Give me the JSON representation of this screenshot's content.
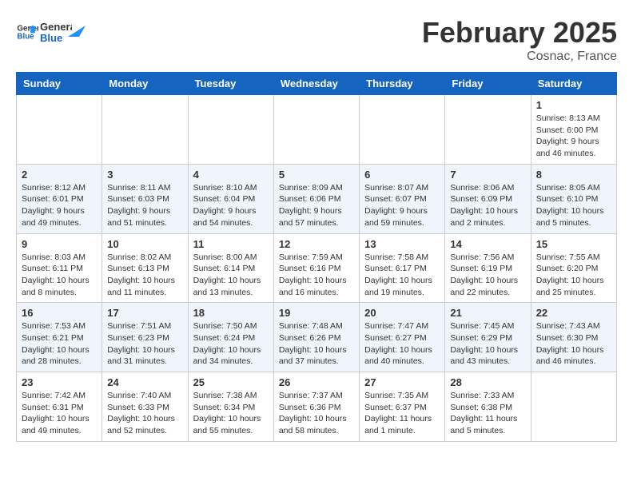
{
  "header": {
    "logo_line1": "General",
    "logo_line2": "Blue",
    "month_title": "February 2025",
    "location": "Cosnac, France"
  },
  "weekdays": [
    "Sunday",
    "Monday",
    "Tuesday",
    "Wednesday",
    "Thursday",
    "Friday",
    "Saturday"
  ],
  "weeks": [
    [
      {
        "day": "",
        "info": ""
      },
      {
        "day": "",
        "info": ""
      },
      {
        "day": "",
        "info": ""
      },
      {
        "day": "",
        "info": ""
      },
      {
        "day": "",
        "info": ""
      },
      {
        "day": "",
        "info": ""
      },
      {
        "day": "1",
        "info": "Sunrise: 8:13 AM\nSunset: 6:00 PM\nDaylight: 9 hours and 46 minutes."
      }
    ],
    [
      {
        "day": "2",
        "info": "Sunrise: 8:12 AM\nSunset: 6:01 PM\nDaylight: 9 hours and 49 minutes."
      },
      {
        "day": "3",
        "info": "Sunrise: 8:11 AM\nSunset: 6:03 PM\nDaylight: 9 hours and 51 minutes."
      },
      {
        "day": "4",
        "info": "Sunrise: 8:10 AM\nSunset: 6:04 PM\nDaylight: 9 hours and 54 minutes."
      },
      {
        "day": "5",
        "info": "Sunrise: 8:09 AM\nSunset: 6:06 PM\nDaylight: 9 hours and 57 minutes."
      },
      {
        "day": "6",
        "info": "Sunrise: 8:07 AM\nSunset: 6:07 PM\nDaylight: 9 hours and 59 minutes."
      },
      {
        "day": "7",
        "info": "Sunrise: 8:06 AM\nSunset: 6:09 PM\nDaylight: 10 hours and 2 minutes."
      },
      {
        "day": "8",
        "info": "Sunrise: 8:05 AM\nSunset: 6:10 PM\nDaylight: 10 hours and 5 minutes."
      }
    ],
    [
      {
        "day": "9",
        "info": "Sunrise: 8:03 AM\nSunset: 6:11 PM\nDaylight: 10 hours and 8 minutes."
      },
      {
        "day": "10",
        "info": "Sunrise: 8:02 AM\nSunset: 6:13 PM\nDaylight: 10 hours and 11 minutes."
      },
      {
        "day": "11",
        "info": "Sunrise: 8:00 AM\nSunset: 6:14 PM\nDaylight: 10 hours and 13 minutes."
      },
      {
        "day": "12",
        "info": "Sunrise: 7:59 AM\nSunset: 6:16 PM\nDaylight: 10 hours and 16 minutes."
      },
      {
        "day": "13",
        "info": "Sunrise: 7:58 AM\nSunset: 6:17 PM\nDaylight: 10 hours and 19 minutes."
      },
      {
        "day": "14",
        "info": "Sunrise: 7:56 AM\nSunset: 6:19 PM\nDaylight: 10 hours and 22 minutes."
      },
      {
        "day": "15",
        "info": "Sunrise: 7:55 AM\nSunset: 6:20 PM\nDaylight: 10 hours and 25 minutes."
      }
    ],
    [
      {
        "day": "16",
        "info": "Sunrise: 7:53 AM\nSunset: 6:21 PM\nDaylight: 10 hours and 28 minutes."
      },
      {
        "day": "17",
        "info": "Sunrise: 7:51 AM\nSunset: 6:23 PM\nDaylight: 10 hours and 31 minutes."
      },
      {
        "day": "18",
        "info": "Sunrise: 7:50 AM\nSunset: 6:24 PM\nDaylight: 10 hours and 34 minutes."
      },
      {
        "day": "19",
        "info": "Sunrise: 7:48 AM\nSunset: 6:26 PM\nDaylight: 10 hours and 37 minutes."
      },
      {
        "day": "20",
        "info": "Sunrise: 7:47 AM\nSunset: 6:27 PM\nDaylight: 10 hours and 40 minutes."
      },
      {
        "day": "21",
        "info": "Sunrise: 7:45 AM\nSunset: 6:29 PM\nDaylight: 10 hours and 43 minutes."
      },
      {
        "day": "22",
        "info": "Sunrise: 7:43 AM\nSunset: 6:30 PM\nDaylight: 10 hours and 46 minutes."
      }
    ],
    [
      {
        "day": "23",
        "info": "Sunrise: 7:42 AM\nSunset: 6:31 PM\nDaylight: 10 hours and 49 minutes."
      },
      {
        "day": "24",
        "info": "Sunrise: 7:40 AM\nSunset: 6:33 PM\nDaylight: 10 hours and 52 minutes."
      },
      {
        "day": "25",
        "info": "Sunrise: 7:38 AM\nSunset: 6:34 PM\nDaylight: 10 hours and 55 minutes."
      },
      {
        "day": "26",
        "info": "Sunrise: 7:37 AM\nSunset: 6:36 PM\nDaylight: 10 hours and 58 minutes."
      },
      {
        "day": "27",
        "info": "Sunrise: 7:35 AM\nSunset: 6:37 PM\nDaylight: 11 hours and 1 minute."
      },
      {
        "day": "28",
        "info": "Sunrise: 7:33 AM\nSunset: 6:38 PM\nDaylight: 11 hours and 5 minutes."
      },
      {
        "day": "",
        "info": ""
      }
    ]
  ]
}
